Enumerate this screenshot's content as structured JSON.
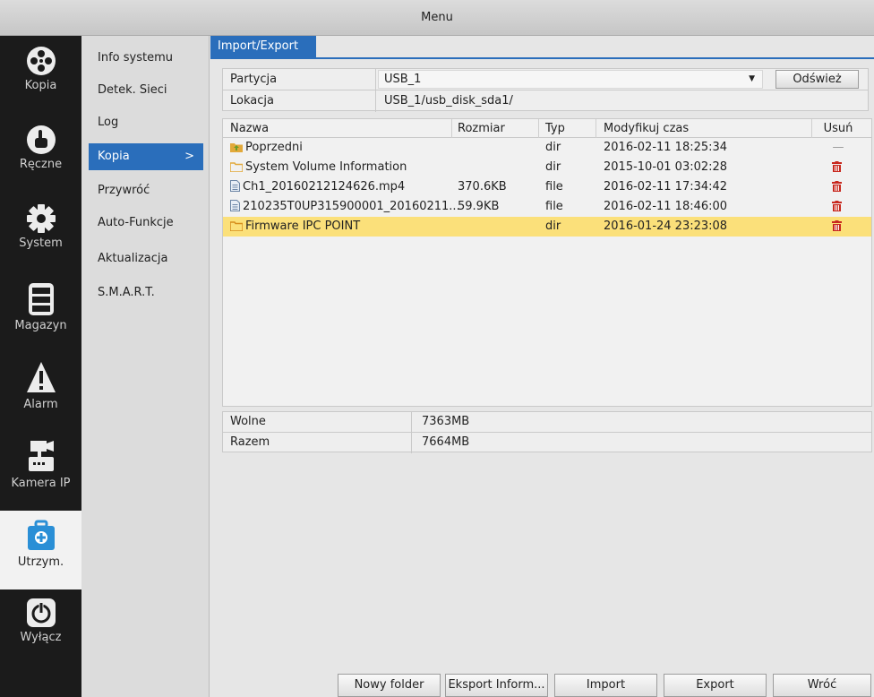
{
  "window": {
    "title": "Menu"
  },
  "sidebar": {
    "items": [
      {
        "label": "Kopia",
        "icon": "film-reel-icon"
      },
      {
        "label": "Ręczne",
        "icon": "hand-pointer-icon"
      },
      {
        "label": "System",
        "icon": "gear-icon"
      },
      {
        "label": "Magazyn",
        "icon": "storage-drive-icon"
      },
      {
        "label": "Alarm",
        "icon": "warning-icon"
      },
      {
        "label": "Kamera IP",
        "icon": "ip-camera-icon"
      },
      {
        "label": "Utrzym.",
        "icon": "maintenance-toolbox-icon",
        "active": true
      },
      {
        "label": "Wyłącz",
        "icon": "power-icon"
      }
    ]
  },
  "subnav": {
    "items": [
      {
        "label": "Info systemu"
      },
      {
        "label": "Detek. Sieci"
      },
      {
        "label": "Log"
      },
      {
        "label": "Kopia",
        "active": true,
        "chevron": ">"
      },
      {
        "label": "Przywróć"
      },
      {
        "label": "Auto-Funkcje"
      },
      {
        "label": "Aktualizacja"
      },
      {
        "label": "S.M.A.R.T."
      }
    ]
  },
  "main": {
    "tab": "Import/Export",
    "form": {
      "partition_label": "Partycja",
      "partition_value": "USB_1",
      "refresh_label": "Odśwież",
      "location_label": "Lokacja",
      "location_value": "USB_1/usb_disk_sda1/"
    },
    "table": {
      "columns": {
        "name": "Nazwa",
        "size": "Rozmiar",
        "type": "Typ",
        "time": "Modyfikuj czas",
        "delete": "Usuń"
      },
      "rows": [
        {
          "icon": "folder-up-icon",
          "name": "Poprzedni",
          "size": "",
          "type": "dir",
          "time": "2016-02-11 18:25:34",
          "delete": "—"
        },
        {
          "icon": "folder-icon",
          "name": "System Volume Information",
          "size": "",
          "type": "dir",
          "time": "2015-10-01 03:02:28",
          "delete": "trash-icon"
        },
        {
          "icon": "file-icon",
          "name": "Ch1_20160212124626.mp4",
          "size": "370.6KB",
          "type": "file",
          "time": "2016-02-11 17:34:42",
          "delete": "trash-icon"
        },
        {
          "icon": "file-icon",
          "name": "210235T0UP315900001_20160211...",
          "size": "59.9KB",
          "type": "file",
          "time": "2016-02-11 18:46:00",
          "delete": "trash-icon"
        },
        {
          "icon": "folder-icon",
          "name": "Firmware IPC POINT",
          "size": "",
          "type": "dir",
          "time": "2016-01-24 23:23:08",
          "delete": "trash-icon",
          "selected": true
        }
      ]
    },
    "summary": {
      "free_label": "Wolne",
      "free_value": "7363MB",
      "total_label": "Razem",
      "total_value": "7664MB"
    },
    "buttons": {
      "new_folder": "Nowy folder",
      "export_info": "Eksport Inform...",
      "import": "Import",
      "export": "Export",
      "back": "Wróć"
    }
  },
  "colors": {
    "accent": "#2a6ebb",
    "selected_row": "#fbe07a",
    "delete_icon": "#c8281e",
    "folder": "#e2a93a"
  }
}
